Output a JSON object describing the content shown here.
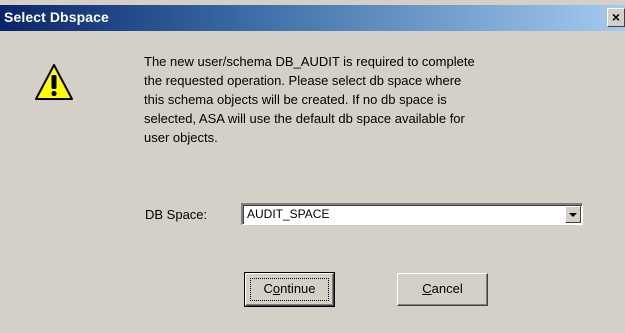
{
  "window": {
    "title": "Select Dbspace",
    "close_glyph": "×"
  },
  "icon": {
    "name": "warning-icon",
    "colors": {
      "fill": "#ffff00",
      "outline": "#000000"
    }
  },
  "message": {
    "text": "The new user/schema DB_AUDIT is required to complete\nthe requested operation.  Please select db space where\nthis schema objects will be created.  If no db space is\nselected, ASA will use the default db space available for\nuser objects."
  },
  "form": {
    "db_space_label": "DB Space:",
    "db_space_value": "AUDIT_SPACE"
  },
  "buttons": {
    "continue_label": "Continue",
    "continue_mnemonic": "o",
    "cancel_label": "Cancel",
    "cancel_mnemonic": "C"
  },
  "colors": {
    "title_bar_start": "#0a246a",
    "title_bar_end": "#a6caf0",
    "dialog_face": "#d4d0c8"
  }
}
